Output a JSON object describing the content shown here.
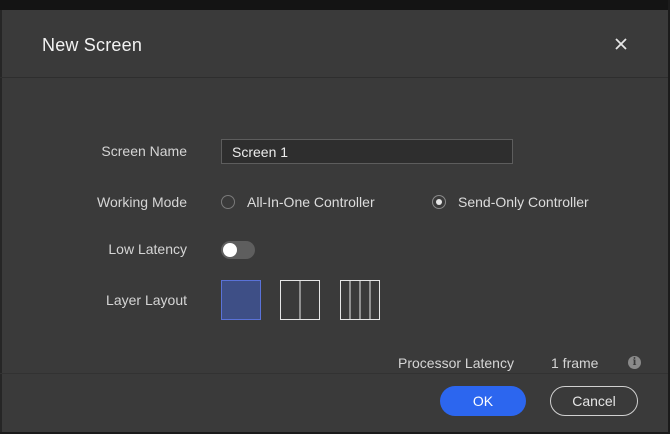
{
  "dialog": {
    "title": "New Screen",
    "close_icon": "close-icon"
  },
  "form": {
    "screen_name": {
      "label": "Screen Name",
      "value": "Screen 1"
    },
    "working_mode": {
      "label": "Working Mode",
      "options": [
        {
          "label": "All-In-One Controller",
          "checked": false
        },
        {
          "label": "Send-Only Controller",
          "checked": true
        }
      ]
    },
    "low_latency": {
      "label": "Low Latency",
      "enabled": false
    },
    "layer_layout": {
      "label": "Layer Layout",
      "options": [
        {
          "name": "single-layer",
          "columns": 1,
          "selected": true
        },
        {
          "name": "two-column",
          "columns": 2,
          "selected": false
        },
        {
          "name": "four-column",
          "columns": 4,
          "selected": false
        }
      ]
    }
  },
  "processor_latency": {
    "label": "Processor Latency",
    "value": "1 frame",
    "info_icon": "info-icon"
  },
  "buttons": {
    "ok": "OK",
    "cancel": "Cancel"
  },
  "colors": {
    "accent": "#2c66ef",
    "selected_layout": "#3e4f86",
    "dialog_bg": "#3a3a3a"
  }
}
